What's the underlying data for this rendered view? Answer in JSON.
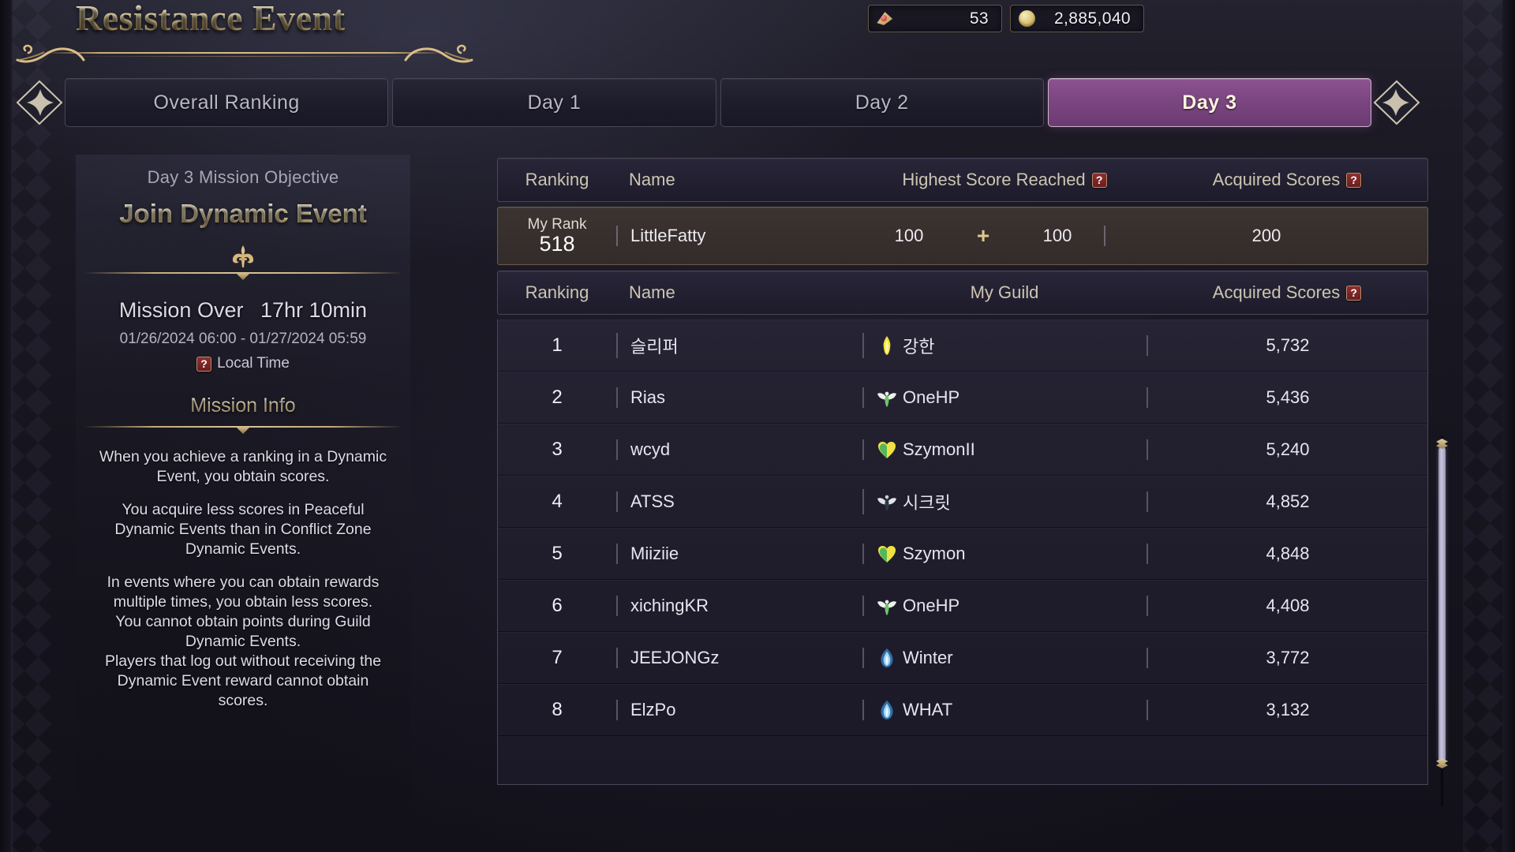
{
  "header": {
    "title": "Resistance Event",
    "currencies": [
      {
        "icon": "gem-icon",
        "value": "53"
      },
      {
        "icon": "coin-icon",
        "value": "2,885,040"
      }
    ]
  },
  "tabs": [
    {
      "label": "Overall Ranking",
      "active": false
    },
    {
      "label": "Day 1",
      "active": false
    },
    {
      "label": "Day 2",
      "active": false
    },
    {
      "label": "Day 3",
      "active": true
    }
  ],
  "left_panel": {
    "objective_label": "Day 3  Mission Objective",
    "objective_title": "Join Dynamic Event",
    "status": "Mission Over",
    "time_remaining": "17hr 10min",
    "date_range": "01/26/2024 06:00 - 01/27/2024 05:59",
    "local_time_label": "Local Time",
    "help_glyph": "?",
    "info_heading": "Mission Info",
    "info_paragraphs": [
      "When you achieve a ranking in a Dynamic Event, you obtain scores.",
      "You acquire less scores in Peaceful Dynamic Events than in Conflict Zone Dynamic Events.",
      "In events where you can obtain rewards multiple times, you obtain less scores.\nYou cannot obtain points during Guild Dynamic Events.\nPlayers that log out without receiving the Dynamic Event reward cannot obtain scores."
    ]
  },
  "personal_table": {
    "headers": {
      "ranking": "Ranking",
      "name": "Name",
      "highest_score": "Highest Score Reached",
      "acquired_scores": "Acquired Scores"
    },
    "my_rank": {
      "rank_label": "My Rank",
      "rank_value": "518",
      "name": "LittleFatty",
      "highest_a": "100",
      "plus": "+",
      "highest_b": "100",
      "acquired": "200"
    }
  },
  "guild_table": {
    "headers": {
      "ranking": "Ranking",
      "name": "Name",
      "my_guild": "My Guild",
      "acquired_scores": "Acquired Scores"
    },
    "rows": [
      {
        "rank": "1",
        "name": "슬리퍼",
        "guild": "강한",
        "emblem": "flame-yellow-emblem",
        "score": "5,732"
      },
      {
        "rank": "2",
        "name": "Rias",
        "guild": "OneHP",
        "emblem": "wings-white-emblem",
        "score": "5,436"
      },
      {
        "rank": "3",
        "name": "wcyd",
        "guild": "SzymonII",
        "emblem": "heart-leaf-emblem",
        "score": "5,240"
      },
      {
        "rank": "4",
        "name": "ATSS",
        "guild": "시크릿",
        "emblem": "wings-dark-emblem",
        "score": "4,852"
      },
      {
        "rank": "5",
        "name": "Miiziie",
        "guild": "Szymon",
        "emblem": "heart-leaf-emblem",
        "score": "4,848"
      },
      {
        "rank": "6",
        "name": "xichingKR",
        "guild": "OneHP",
        "emblem": "wings-white-emblem",
        "score": "4,408"
      },
      {
        "rank": "7",
        "name": "JEEJONGz",
        "guild": "Winter",
        "emblem": "blue-flame-emblem",
        "score": "3,772"
      },
      {
        "rank": "8",
        "name": "ElzPo",
        "guild": "WHAT",
        "emblem": "blue-flame-emblem",
        "score": "3,132"
      }
    ]
  },
  "colors": {
    "accent_gold": "#e0c98e",
    "active_tab": "#7b4681",
    "help_red": "#8d2f2f",
    "panel_bg": "#201e2c"
  }
}
